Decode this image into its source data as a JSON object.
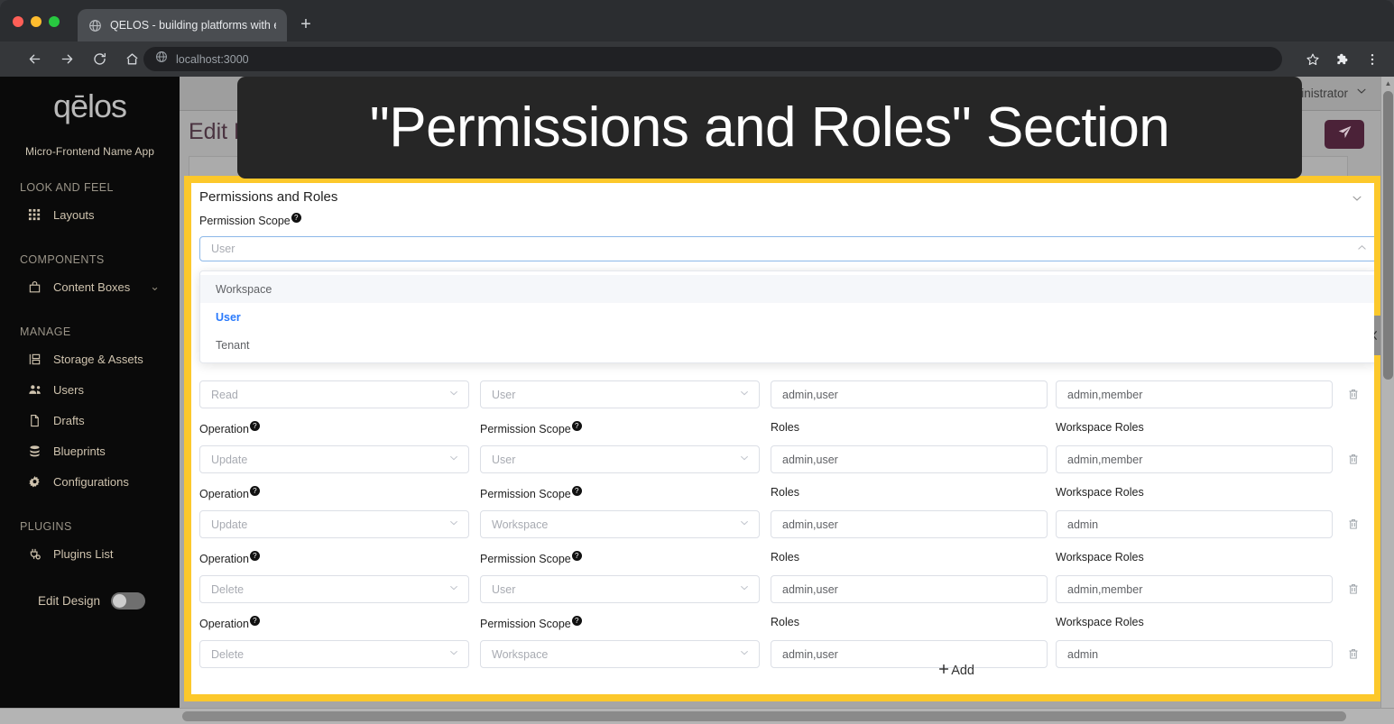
{
  "browser": {
    "tab": {
      "title": "QELOS - building platforms with e",
      "favicon_icon": "globe-icon"
    },
    "new_tab_label": "+",
    "url": "localhost:3000",
    "nav": {
      "back_icon": "arrow-left-icon",
      "forward_icon": "arrow-right-icon",
      "reload_icon": "reload-icon",
      "home_icon": "home-icon"
    },
    "actions": {
      "bookmark_icon": "star-icon",
      "extensions_icon": "puzzle-icon",
      "menu_icon": "three-dots-icon"
    }
  },
  "overlay": {
    "text": "\"Permissions and Roles\" Section"
  },
  "sidebar": {
    "brand": "qēlos",
    "app_name": "Micro-Frontend Name App",
    "groups": [
      {
        "title": "LOOK AND FEEL",
        "items": [
          {
            "label": "Layouts",
            "icon": "grid-icon",
            "chevron": ""
          }
        ]
      },
      {
        "title": "COMPONENTS",
        "items": [
          {
            "label": "Content Boxes",
            "icon": "box-icon",
            "chevron": "⌄"
          }
        ]
      },
      {
        "title": "MANAGE",
        "items": [
          {
            "label": "Storage & Assets",
            "icon": "storage-icon",
            "chevron": ""
          },
          {
            "label": "Users",
            "icon": "users-icon",
            "chevron": ""
          },
          {
            "label": "Drafts",
            "icon": "document-icon",
            "chevron": ""
          },
          {
            "label": "Blueprints",
            "icon": "database-icon",
            "chevron": ""
          },
          {
            "label": "Configurations",
            "icon": "gear-icon",
            "chevron": ""
          }
        ]
      },
      {
        "title": "PLUGINS",
        "items": [
          {
            "label": "Plugins List",
            "icon": "plug-icon",
            "chevron": ""
          }
        ]
      }
    ],
    "edit_design": {
      "label": "Edit Design",
      "enabled": false
    }
  },
  "topbar": {
    "user": "Administrator",
    "user_chevron_icon": "chevron-down-icon"
  },
  "page": {
    "title": "Edit Blueprint Book",
    "send_button_icon": "paper-plane-icon"
  },
  "section": {
    "title": "Permissions and Roles",
    "collapse_icon": "chevron-down-icon",
    "scope_field": {
      "label": "Permission Scope",
      "help_glyph": "?",
      "value": "",
      "placeholder": "User",
      "chevron_icon": "chevron-up-icon",
      "open": true
    },
    "dropdown_options": [
      {
        "label": "Workspace",
        "state": "hover"
      },
      {
        "label": "User",
        "state": "selected"
      },
      {
        "label": "Tenant",
        "state": "normal"
      }
    ],
    "column_labels": {
      "operation": "Operation",
      "permission_scope": "Permission Scope",
      "roles": "Roles",
      "workspace_roles": "Workspace Roles"
    },
    "rows": [
      {
        "show_labels": false,
        "operation": "Read",
        "permission_scope": "User",
        "roles": "admin,user",
        "workspace_roles": "admin,member",
        "delete_icon": "trash-icon"
      },
      {
        "show_labels": true,
        "operation": "Update",
        "permission_scope": "User",
        "roles": "admin,user",
        "workspace_roles": "admin,member",
        "delete_icon": "trash-icon"
      },
      {
        "show_labels": true,
        "operation": "Update",
        "permission_scope": "Workspace",
        "roles": "admin,user",
        "workspace_roles": "admin",
        "delete_icon": "trash-icon"
      },
      {
        "show_labels": true,
        "operation": "Delete",
        "permission_scope": "User",
        "roles": "admin,user",
        "workspace_roles": "admin,member",
        "delete_icon": "trash-icon"
      },
      {
        "show_labels": true,
        "operation": "Delete",
        "permission_scope": "Workspace",
        "roles": "admin,user",
        "workspace_roles": "admin",
        "delete_icon": "trash-icon"
      }
    ],
    "add_button": {
      "label": "Add",
      "icon": "plus-icon"
    }
  },
  "scrollbars": {
    "vertical_up_icon": "triangle-up-icon",
    "vertical_down_icon": "triangle-down-icon",
    "collapse_handle_icon": "chevron-left-icon"
  },
  "colors": {
    "highlight": "#fcc82b",
    "accent_blue": "#2a7afc",
    "send_button": "#4b2238",
    "sidebar_bg": "#0a0a0a"
  }
}
